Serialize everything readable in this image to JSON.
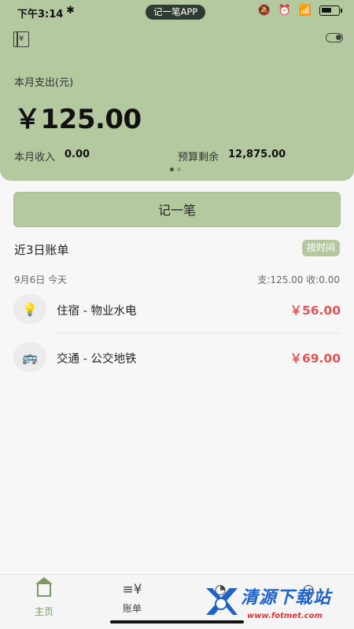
{
  "status_bar": {
    "time": "下午3:14",
    "bt": "✱",
    "app_pill": "记一笔APP",
    "icons": [
      "mute-icon",
      "alarm-icon",
      "wifi-icon",
      "battery-icon"
    ]
  },
  "header": {
    "month_expense_label": "本月支出(元)",
    "month_expense_value": "￥125.00",
    "month_income_label": "本月收入",
    "month_income_value": "0.00",
    "budget_remaining_label": "预算剩余",
    "budget_remaining_value": "12,875.00",
    "book_icon_glyph": "¥",
    "bg_color": "#b5c9a0"
  },
  "record_button": {
    "label": "记一笔"
  },
  "recent": {
    "title": "近3日账单",
    "sort_label": "按时间",
    "days": [
      {
        "date": "9月6日  今天",
        "summary": "支:125.00  收:0.00",
        "items": [
          {
            "icon": "lightbulb-icon",
            "glyph": "💡",
            "label": "住宿 - 物业水电",
            "amount": "￥56.00"
          },
          {
            "icon": "bus-icon",
            "glyph": "🚌",
            "label": "交通 - 公交地铁",
            "amount": "￥69.00"
          }
        ]
      }
    ]
  },
  "bottom_nav": {
    "items": [
      {
        "label": "主页",
        "icon": "home-icon",
        "active": true
      },
      {
        "label": "账单",
        "icon": "bill-icon",
        "active": false
      },
      {
        "label": "",
        "icon": "stats-icon",
        "active": false
      },
      {
        "label": "",
        "icon": "profile-icon",
        "active": false
      }
    ],
    "bill_icon_glyph": "≡¥",
    "stats_icon_glyph": "◔",
    "profile_icon_glyph": "○"
  },
  "watermark": {
    "text": "清源下载站",
    "sub": "www.fotmet.com"
  },
  "colors": {
    "accent": "#b5c9a0",
    "nav_active": "#7d9a63",
    "amount": "#e05555"
  }
}
